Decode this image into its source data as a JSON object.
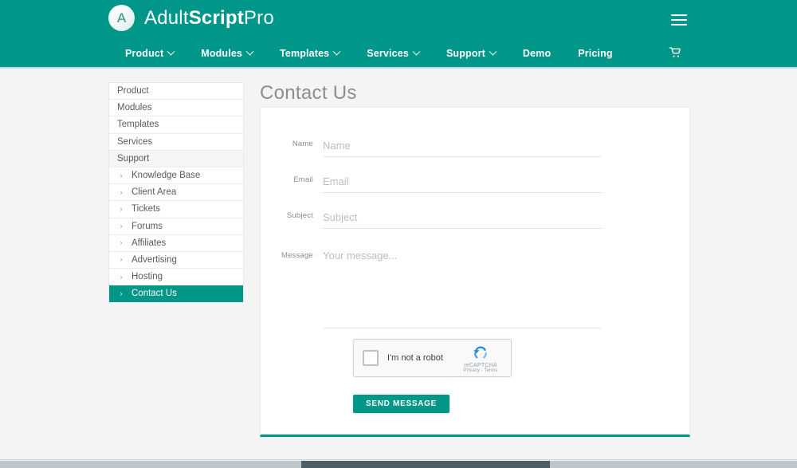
{
  "header": {
    "logo_badge": "A",
    "logo_part1": "Adult",
    "logo_part2": "Script",
    "logo_part3": "Pro",
    "menu_icon": "hamburger-icon",
    "cart_icon": "shopping-cart-icon",
    "brand_color": "#00968a"
  },
  "nav": {
    "items": [
      {
        "label": "Product",
        "has_caret": true
      },
      {
        "label": "Modules",
        "has_caret": true
      },
      {
        "label": "Templates",
        "has_caret": true
      },
      {
        "label": "Services",
        "has_caret": true
      },
      {
        "label": "Support",
        "has_caret": true
      },
      {
        "label": "Demo",
        "has_caret": false
      },
      {
        "label": "Pricing",
        "has_caret": false
      }
    ]
  },
  "sidebar": {
    "items": [
      {
        "label": "Product",
        "sub": false,
        "state": "normal"
      },
      {
        "label": "Modules",
        "sub": false,
        "state": "normal"
      },
      {
        "label": "Templates",
        "sub": false,
        "state": "normal"
      },
      {
        "label": "Services",
        "sub": false,
        "state": "normal"
      },
      {
        "label": "Support",
        "sub": false,
        "state": "section"
      },
      {
        "label": "Knowledge Base",
        "sub": true,
        "state": "normal"
      },
      {
        "label": "Client Area",
        "sub": true,
        "state": "normal"
      },
      {
        "label": "Tickets",
        "sub": true,
        "state": "normal"
      },
      {
        "label": "Forums",
        "sub": true,
        "state": "normal"
      },
      {
        "label": "Affiliates",
        "sub": true,
        "state": "normal"
      },
      {
        "label": "Advertising",
        "sub": true,
        "state": "normal"
      },
      {
        "label": "Hosting",
        "sub": true,
        "state": "normal"
      },
      {
        "label": "Contact Us",
        "sub": true,
        "state": "current"
      }
    ],
    "chevron": "›",
    "active_color": "#009688"
  },
  "main": {
    "page_title": "Contact Us",
    "form": {
      "fields": [
        {
          "label": "Name",
          "placeholder": "Name",
          "value": "",
          "type": "text"
        },
        {
          "label": "Email",
          "placeholder": "Email",
          "value": "",
          "type": "text"
        },
        {
          "label": "Subject",
          "placeholder": "Subject",
          "value": "",
          "type": "text"
        },
        {
          "label": "Message",
          "placeholder": "Your message...",
          "value": "",
          "type": "textarea"
        }
      ],
      "recaptcha": {
        "checkbox_label": "I'm not a robot",
        "brand_name": "reCAPTCHA",
        "links": "Privacy - Terms",
        "logo_icon": "recaptcha-logo-icon",
        "checked": false
      },
      "submit_label": "SEND MESSAGE"
    }
  }
}
